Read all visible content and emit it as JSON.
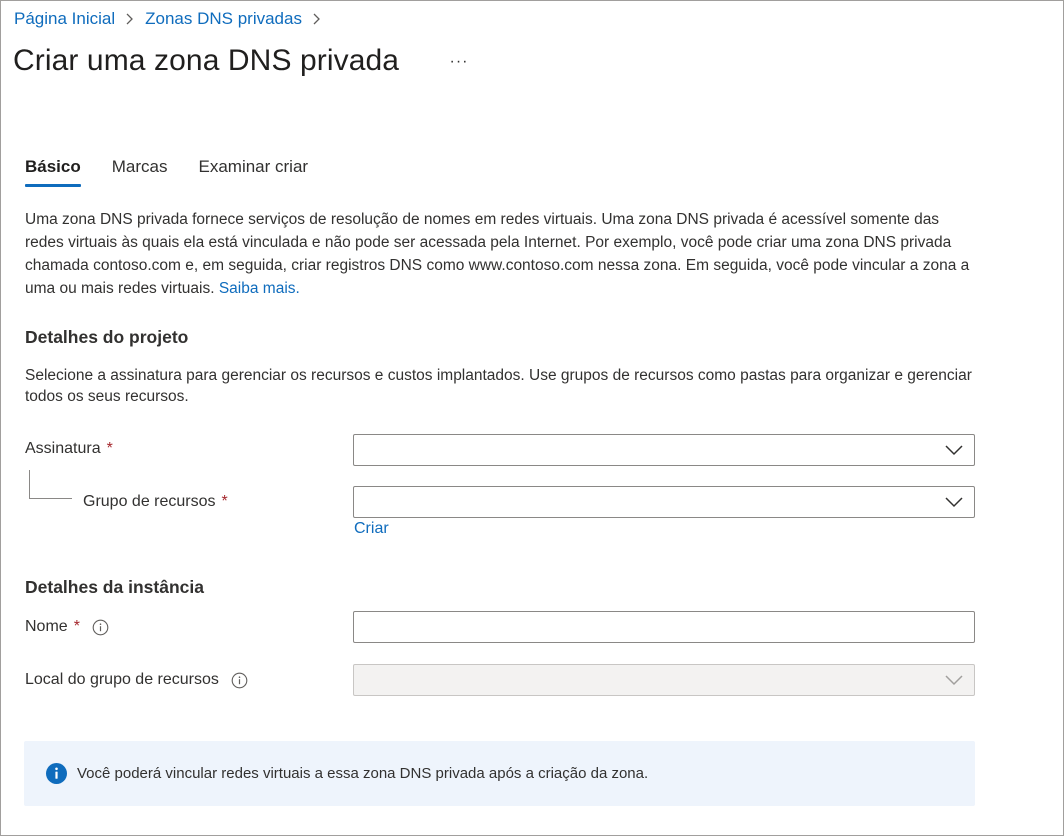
{
  "breadcrumb": {
    "items": [
      "Página Inicial",
      "Zonas DNS privadas"
    ]
  },
  "page": {
    "title": "Criar uma zona DNS privada",
    "more_label": "···"
  },
  "tabs": [
    {
      "label": "Básico",
      "active": true
    },
    {
      "label": "Marcas",
      "active": false
    },
    {
      "label": "Examinar criar",
      "active": false
    }
  ],
  "intro": {
    "text": "Uma zona DNS privada fornece serviços de resolução de nomes em redes virtuais. Uma zona DNS privada é acessível somente das redes virtuais às quais ela está vinculada e não pode ser acessada pela Internet. Por exemplo, você pode criar uma zona DNS privada chamada contoso.com e, em seguida, criar registros DNS como www.contoso.com nessa zona. Em seguida, você pode vincular a zona a uma ou mais redes virtuais.",
    "learn_more": "Saiba mais."
  },
  "project": {
    "heading": "Detalhes do projeto",
    "description": "Selecione a assinatura para gerenciar os recursos e custos implantados. Use grupos de recursos como pastas para organizar e gerenciar todos os seus recursos.",
    "subscription_label": "Assinatura",
    "subscription_value": "",
    "resource_group_label": "Grupo de recursos",
    "resource_group_value": "",
    "create_link": "Criar",
    "required_mark": "*"
  },
  "instance": {
    "heading": "Detalhes da instância",
    "name_label": "Nome",
    "name_value": "",
    "location_label": "Local do grupo de recursos",
    "location_value": ""
  },
  "info_bar": {
    "text": "Você poderá vincular redes virtuais a essa zona DNS privada após a criação da zona."
  },
  "icons": {
    "breadcrumb_separator": "chevron-right-icon",
    "select_chevron": "chevron-down-icon",
    "field_info": "info-icon",
    "info_bar": "info-filled-icon"
  },
  "colors": {
    "accent": "#0f6cbd",
    "required": "#a4262c",
    "info_bar_bg": "#eef4fc"
  }
}
